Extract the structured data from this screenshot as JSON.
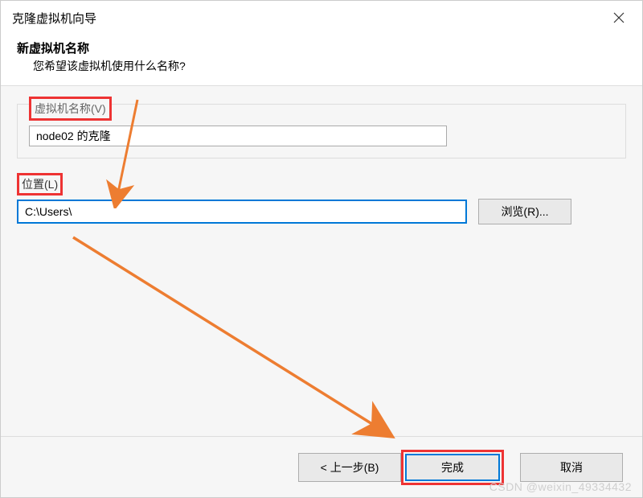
{
  "window": {
    "title": "克隆虚拟机向导"
  },
  "header": {
    "title": "新虚拟机名称",
    "subtitle": "您希望该虚拟机使用什么名称?"
  },
  "form": {
    "vmname_label": "虚拟机名称(V)",
    "vmname_value": "node02 的克隆",
    "location_label": "位置(L)",
    "location_value": "C:\\Users\\",
    "browse_label": "浏览(R)..."
  },
  "footer": {
    "back_label": "< 上一步(B)",
    "finish_label": "完成",
    "cancel_label": "取消"
  },
  "watermark": "CSDN @weixin_49334432"
}
